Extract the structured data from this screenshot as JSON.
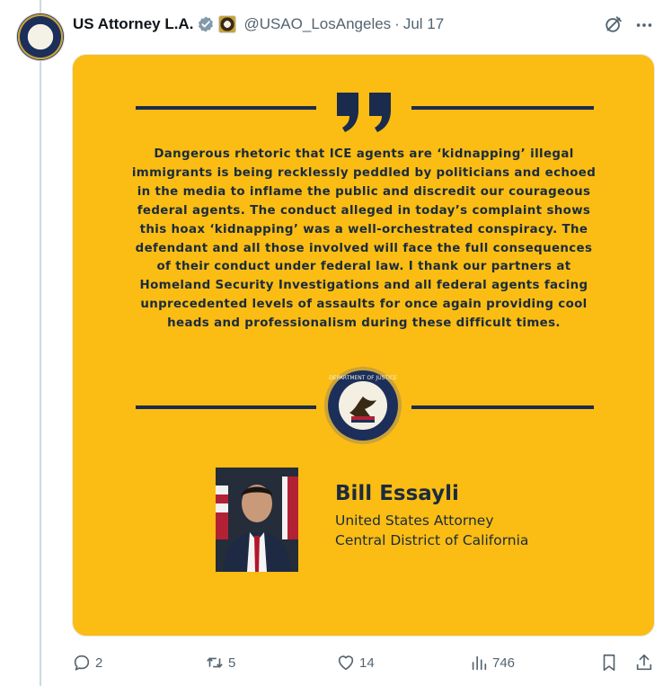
{
  "post": {
    "display_name": "US Attorney L.A.",
    "handle": "@USAO_LosAngeles",
    "separator": "·",
    "date": "Jul 17"
  },
  "card": {
    "quote": "Dangerous rhetoric that ICE agents are ‘kidnapping’ illegal immigrants is being recklessly peddled by politicians and echoed in the media to inflame the public and discredit our courageous federal agents. The conduct alleged in today’s complaint shows this hoax ‘kidnapping’ was a well-orchestrated conspiracy. The defendant and all those involved will face the full consequences of their conduct under federal law. I thank our partners at Homeland Security Investigations and all federal agents facing unprecedented levels of assaults for once again providing cool heads and professionalism during these difficult times.",
    "speaker_name": "Bill Essayli",
    "speaker_title": "United States Attorney",
    "speaker_district": "Central District of California",
    "seal_text": "DEPARTMENT OF JUSTICE",
    "background_color": "#fbbd13",
    "ink_color": "#1b2b4d"
  },
  "actions": {
    "replies": "2",
    "reposts": "5",
    "likes": "14",
    "views": "746"
  },
  "icons": {
    "verified": "verified-badge-icon",
    "affiliation": "doj-affiliation-icon",
    "grok": "grok-icon",
    "more": "more-icon",
    "reply": "reply-icon",
    "repost": "repost-icon",
    "like": "heart-icon",
    "views": "views-chart-icon",
    "bookmark": "bookmark-icon",
    "share": "share-icon"
  },
  "colors": {
    "verified_blue": "#1d9bf0",
    "muted_text": "#536471"
  }
}
